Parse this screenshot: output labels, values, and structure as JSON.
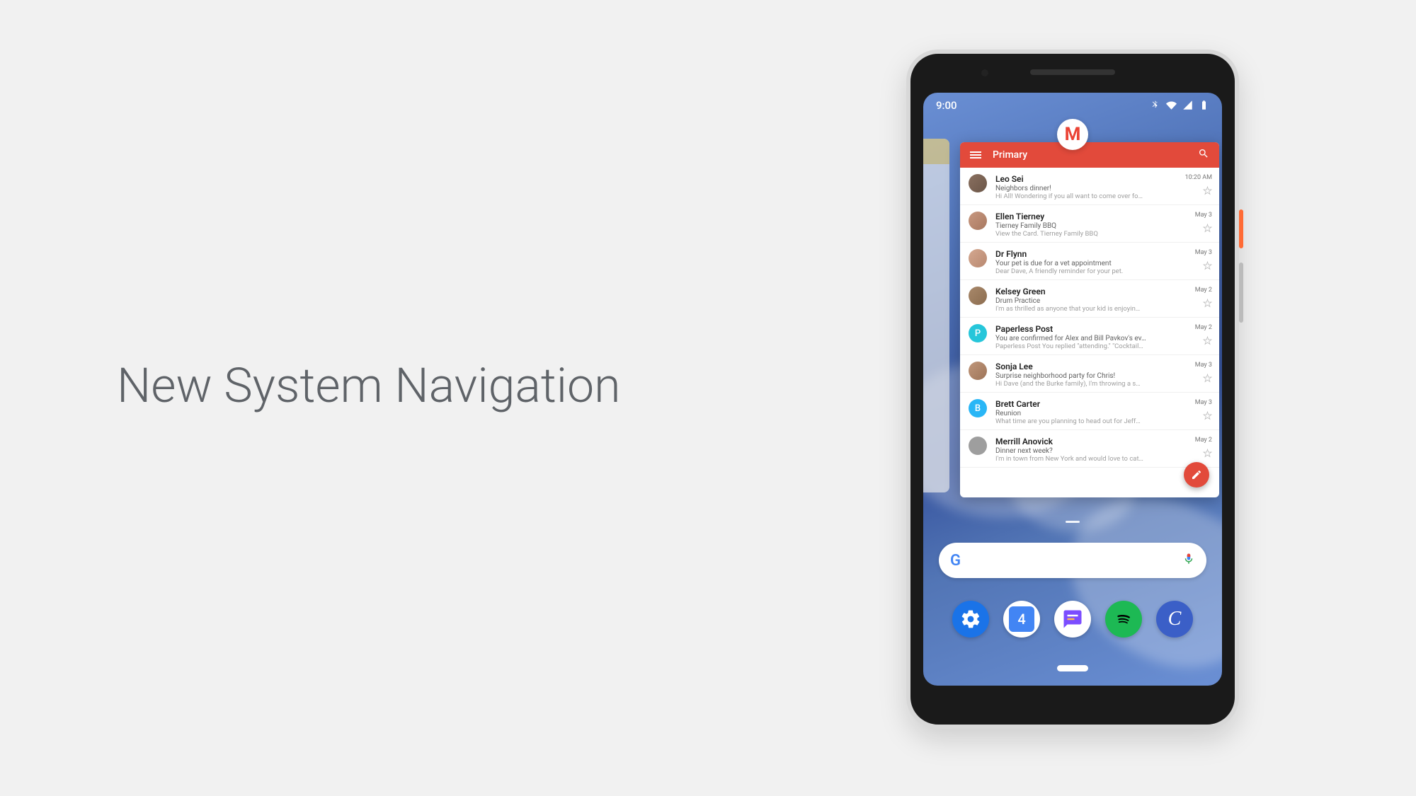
{
  "slide": {
    "title": "New System Navigation"
  },
  "statusbar": {
    "time": "9:00"
  },
  "gmail": {
    "header": {
      "title": "Primary"
    },
    "emails": [
      {
        "sender": "Leo Sei",
        "subject": "Neighbors dinner!",
        "preview": "Hi All! Wondering if you all want to come over fo…",
        "time": "10:20 AM",
        "avatar": "av-photo1"
      },
      {
        "sender": "Ellen Tierney",
        "subject": "Tierney Family BBQ",
        "preview": "View the Card. Tierney Family BBQ",
        "time": "May 3",
        "avatar": "av-photo2"
      },
      {
        "sender": "Dr Flynn",
        "subject": "Your pet is due for a vet appointment",
        "preview": "Dear Dave, A friendly reminder for your pet.",
        "time": "May 3",
        "avatar": "av-photo3"
      },
      {
        "sender": "Kelsey Green",
        "subject": "Drum Practice",
        "preview": "I'm as thrilled as anyone that your kid is enjoyin…",
        "time": "May 2",
        "avatar": "av-photo4"
      },
      {
        "sender": "Paperless Post",
        "subject": "You are confirmed for Alex and Bill Pavkov's ev…",
        "preview": "Paperless Post You replied \"attending.\" \"Cocktail…",
        "time": "May 2",
        "avatar": "av-teal",
        "letter": "P"
      },
      {
        "sender": "Sonja Lee",
        "subject": "Surprise neighborhood party for Chris!",
        "preview": "Hi Dave (and the Burke family), I'm throwing a s…",
        "time": "May 3",
        "avatar": "av-photo5"
      },
      {
        "sender": "Brett Carter",
        "subject": "Reunion",
        "preview": "What time are you planning to head out for Jeff…",
        "time": "May 3",
        "avatar": "av-blue",
        "letter": "B"
      },
      {
        "sender": "Merrill Anovick",
        "subject": "Dinner next week?",
        "preview": "I'm in town from New York and would love to cat…",
        "time": "May 2",
        "avatar": "av-gray"
      }
    ]
  },
  "dock": {
    "calendar_day": "4",
    "c_app_letter": "C"
  }
}
